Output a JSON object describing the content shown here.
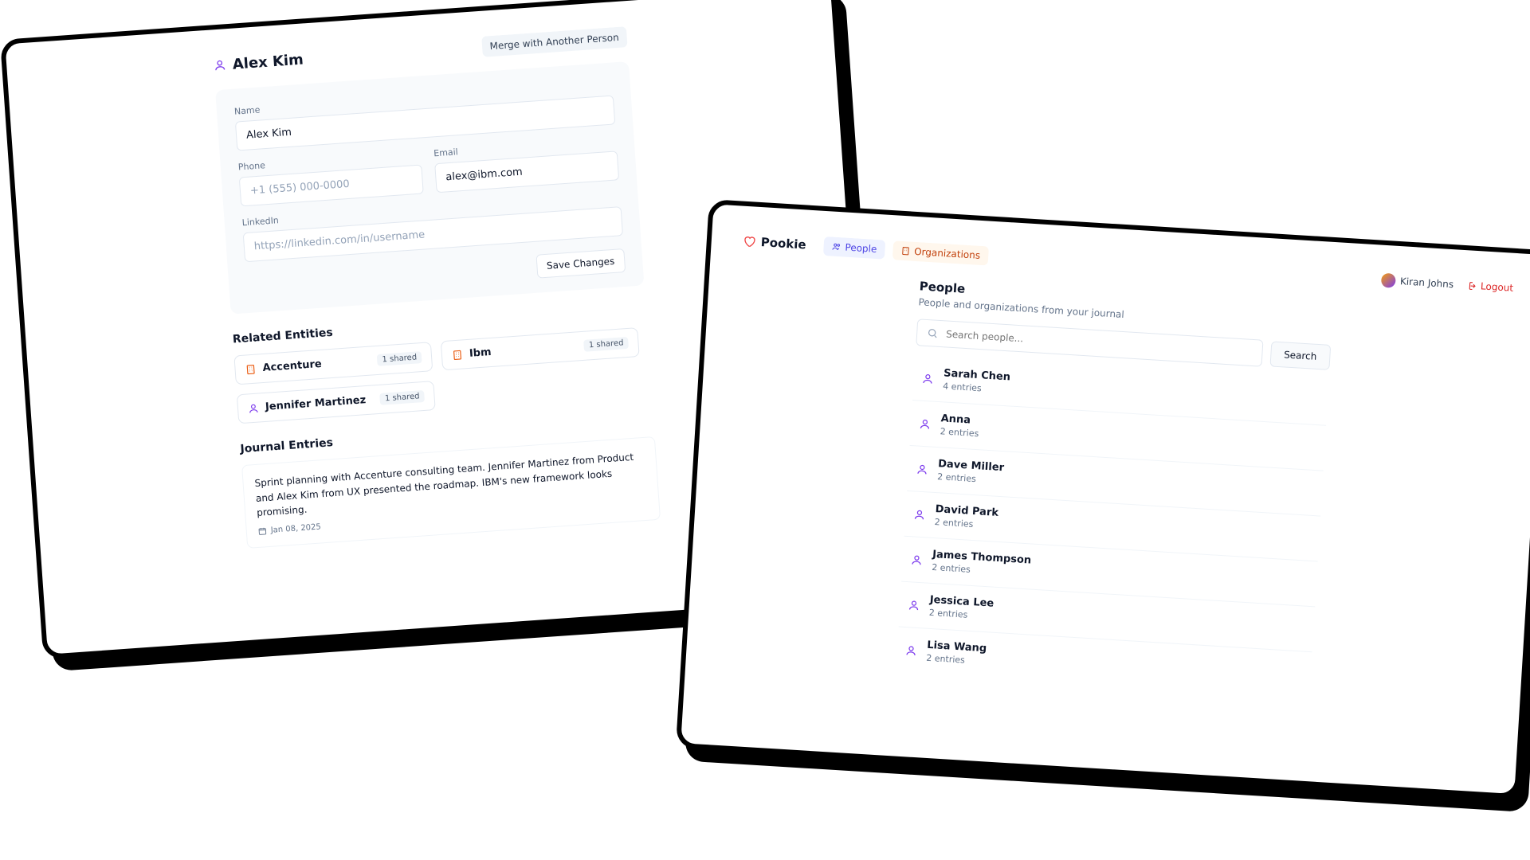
{
  "frameA": {
    "person_name": "Alex Kim",
    "merge_button": "Merge with Another Person",
    "form": {
      "name_label": "Name",
      "name_value": "Alex Kim",
      "phone_label": "Phone",
      "phone_placeholder": "+1 (555) 000-0000",
      "email_label": "Email",
      "email_value": "alex@ibm.com",
      "linkedin_label": "LinkedIn",
      "linkedin_placeholder": "https://linkedin.com/in/username",
      "save_button": "Save Changes"
    },
    "related_title": "Related Entities",
    "related": [
      {
        "type": "org",
        "name": "Accenture",
        "shared": "1 shared"
      },
      {
        "type": "org",
        "name": "Ibm",
        "shared": "1 shared"
      },
      {
        "type": "person",
        "name": "Jennifer Martinez",
        "shared": "1 shared"
      }
    ],
    "journal_title": "Journal Entries",
    "journal": {
      "text": "Sprint planning with Accenture consulting team. Jennifer Martinez from Product and Alex Kim from UX presented the roadmap. IBM's new framework looks promising.",
      "date": "Jan 08, 2025"
    }
  },
  "frameB": {
    "brand": "Pookie",
    "tabs": {
      "people": "People",
      "orgs": "Organizations"
    },
    "user": "Kiran Johns",
    "logout": "Logout",
    "heading": "People",
    "sub": "People and organizations from your journal",
    "search_placeholder": "Search people...",
    "search_button": "Search",
    "people": [
      {
        "name": "Sarah Chen",
        "entries": "4 entries"
      },
      {
        "name": "Anna",
        "entries": "2 entries"
      },
      {
        "name": "Dave Miller",
        "entries": "2 entries"
      },
      {
        "name": "David Park",
        "entries": "2 entries"
      },
      {
        "name": "James Thompson",
        "entries": "2 entries"
      },
      {
        "name": "Jessica Lee",
        "entries": "2 entries"
      },
      {
        "name": "Lisa Wang",
        "entries": "2 entries"
      }
    ]
  },
  "colors": {
    "person_icon": "#7c3aed",
    "org_icon": "#ea580c",
    "heart": "#ef4444"
  }
}
